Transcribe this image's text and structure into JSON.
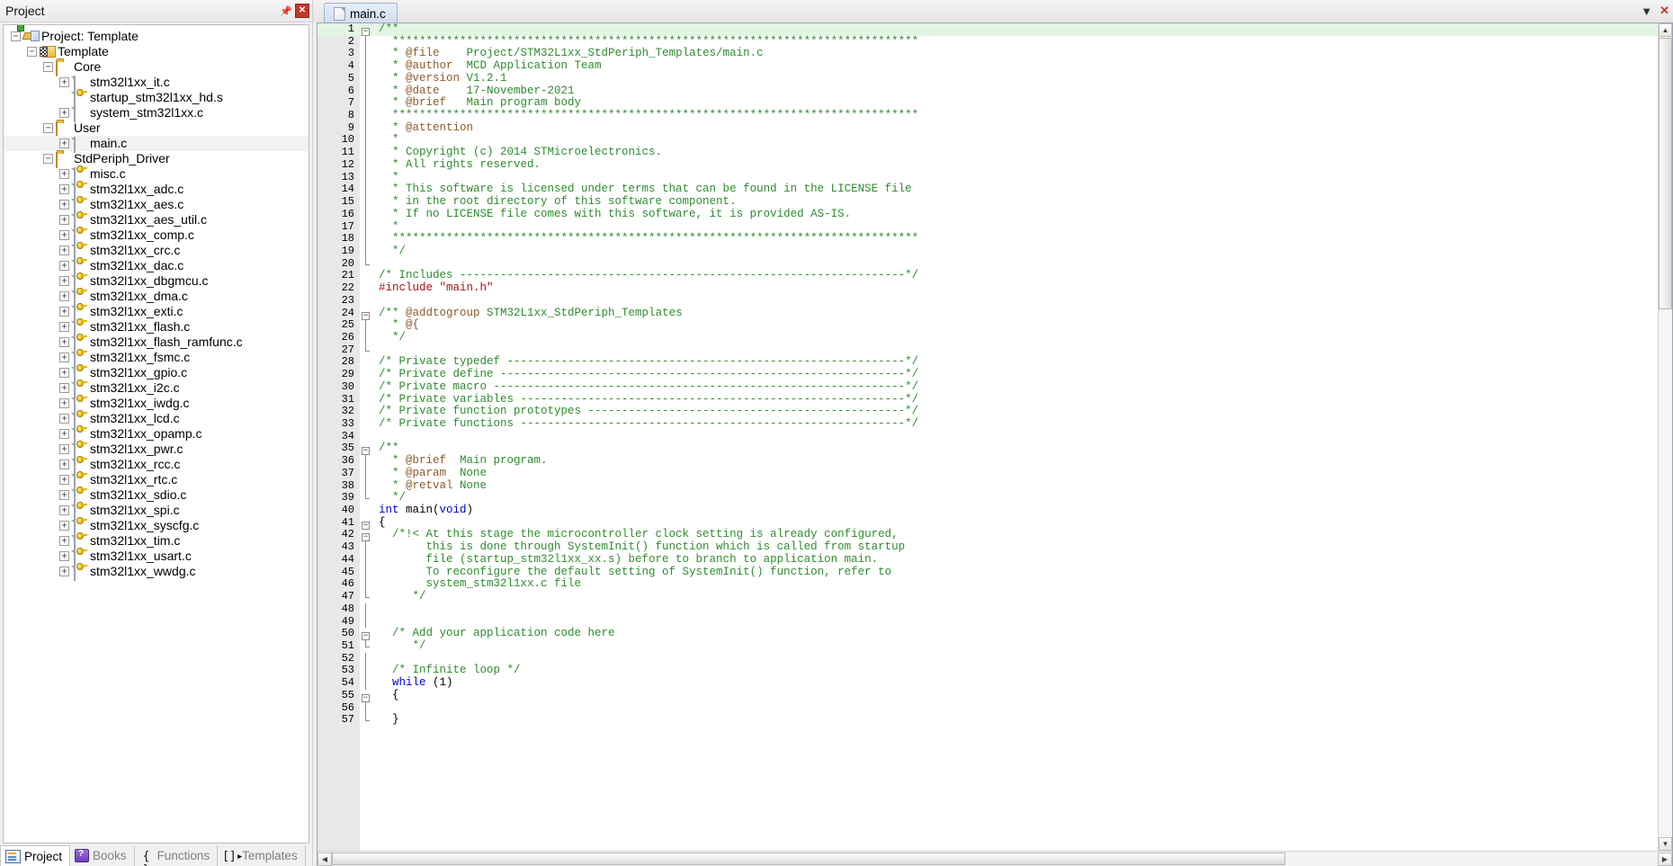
{
  "project_pane": {
    "title": "Project",
    "pin_icon": "pin-icon",
    "close_icon": "close-icon",
    "tree": [
      {
        "label": "Project: Template",
        "depth": 0,
        "icon": "project-icon",
        "expander": "minus"
      },
      {
        "label": "Template",
        "depth": 1,
        "icon": "target-icon",
        "expander": "minus"
      },
      {
        "label": "Core",
        "depth": 2,
        "icon": "folder-icon",
        "expander": "minus"
      },
      {
        "label": "stm32l1xx_it.c",
        "depth": 3,
        "icon": "file-icon",
        "expander": "plus"
      },
      {
        "label": "startup_stm32l1xx_hd.s",
        "depth": 3,
        "icon": "file-key-icon",
        "expander": "none"
      },
      {
        "label": "system_stm32l1xx.c",
        "depth": 3,
        "icon": "file-icon",
        "expander": "plus"
      },
      {
        "label": "User",
        "depth": 2,
        "icon": "folder-icon",
        "expander": "minus"
      },
      {
        "label": "main.c",
        "depth": 3,
        "icon": "file-icon",
        "expander": "plus",
        "selected": true
      },
      {
        "label": "StdPeriph_Driver",
        "depth": 2,
        "icon": "folder-icon",
        "expander": "minus"
      },
      {
        "label": "misc.c",
        "depth": 3,
        "icon": "file-key-icon",
        "expander": "plus"
      },
      {
        "label": "stm32l1xx_adc.c",
        "depth": 3,
        "icon": "file-key-icon",
        "expander": "plus"
      },
      {
        "label": "stm32l1xx_aes.c",
        "depth": 3,
        "icon": "file-key-icon",
        "expander": "plus"
      },
      {
        "label": "stm32l1xx_aes_util.c",
        "depth": 3,
        "icon": "file-key-icon",
        "expander": "plus"
      },
      {
        "label": "stm32l1xx_comp.c",
        "depth": 3,
        "icon": "file-key-icon",
        "expander": "plus"
      },
      {
        "label": "stm32l1xx_crc.c",
        "depth": 3,
        "icon": "file-key-icon",
        "expander": "plus"
      },
      {
        "label": "stm32l1xx_dac.c",
        "depth": 3,
        "icon": "file-key-icon",
        "expander": "plus"
      },
      {
        "label": "stm32l1xx_dbgmcu.c",
        "depth": 3,
        "icon": "file-key-icon",
        "expander": "plus"
      },
      {
        "label": "stm32l1xx_dma.c",
        "depth": 3,
        "icon": "file-key-icon",
        "expander": "plus"
      },
      {
        "label": "stm32l1xx_exti.c",
        "depth": 3,
        "icon": "file-key-icon",
        "expander": "plus"
      },
      {
        "label": "stm32l1xx_flash.c",
        "depth": 3,
        "icon": "file-key-icon",
        "expander": "plus"
      },
      {
        "label": "stm32l1xx_flash_ramfunc.c",
        "depth": 3,
        "icon": "file-key-icon",
        "expander": "plus"
      },
      {
        "label": "stm32l1xx_fsmc.c",
        "depth": 3,
        "icon": "file-key-icon",
        "expander": "plus"
      },
      {
        "label": "stm32l1xx_gpio.c",
        "depth": 3,
        "icon": "file-key-icon",
        "expander": "plus"
      },
      {
        "label": "stm32l1xx_i2c.c",
        "depth": 3,
        "icon": "file-key-icon",
        "expander": "plus"
      },
      {
        "label": "stm32l1xx_iwdg.c",
        "depth": 3,
        "icon": "file-key-icon",
        "expander": "plus"
      },
      {
        "label": "stm32l1xx_lcd.c",
        "depth": 3,
        "icon": "file-key-icon",
        "expander": "plus"
      },
      {
        "label": "stm32l1xx_opamp.c",
        "depth": 3,
        "icon": "file-key-icon",
        "expander": "plus"
      },
      {
        "label": "stm32l1xx_pwr.c",
        "depth": 3,
        "icon": "file-key-icon",
        "expander": "plus"
      },
      {
        "label": "stm32l1xx_rcc.c",
        "depth": 3,
        "icon": "file-key-icon",
        "expander": "plus"
      },
      {
        "label": "stm32l1xx_rtc.c",
        "depth": 3,
        "icon": "file-key-icon",
        "expander": "plus"
      },
      {
        "label": "stm32l1xx_sdio.c",
        "depth": 3,
        "icon": "file-key-icon",
        "expander": "plus"
      },
      {
        "label": "stm32l1xx_spi.c",
        "depth": 3,
        "icon": "file-key-icon",
        "expander": "plus"
      },
      {
        "label": "stm32l1xx_syscfg.c",
        "depth": 3,
        "icon": "file-key-icon",
        "expander": "plus"
      },
      {
        "label": "stm32l1xx_tim.c",
        "depth": 3,
        "icon": "file-key-icon",
        "expander": "plus"
      },
      {
        "label": "stm32l1xx_usart.c",
        "depth": 3,
        "icon": "file-key-icon",
        "expander": "plus"
      },
      {
        "label": "stm32l1xx_wwdg.c",
        "depth": 3,
        "icon": "file-key-icon",
        "expander": "plus"
      }
    ],
    "bottom_tabs": [
      {
        "label": "Project",
        "icon": "project-tab-icon",
        "active": true
      },
      {
        "label": "Books",
        "icon": "books-icon",
        "active": false
      },
      {
        "label": "Functions",
        "icon": "braces-icon",
        "active": false
      },
      {
        "label": "Templates",
        "icon": "templates-icon",
        "active": false
      }
    ]
  },
  "editor": {
    "tabs": [
      {
        "label": "main.c",
        "icon": "file-icon",
        "active": true
      }
    ],
    "tabbar_buttons": [
      {
        "name": "tab-list-dropdown",
        "glyph": "▼"
      },
      {
        "name": "close-document",
        "glyph": "✕"
      }
    ],
    "scroll": {
      "v_up_glyph": "▲",
      "v_down_glyph": "▼",
      "h_left_glyph": "◀",
      "h_right_glyph": "▶"
    },
    "code": [
      {
        "n": 1,
        "fold": "start",
        "hl": true,
        "tokens": [
          {
            "t": "/**",
            "c": "cmt"
          }
        ]
      },
      {
        "n": 2,
        "fold": "bar",
        "tokens": [
          {
            "t": "  ******************************************************************************",
            "c": "cmt"
          }
        ]
      },
      {
        "n": 3,
        "fold": "bar",
        "tokens": [
          {
            "t": "  * ",
            "c": "cmt"
          },
          {
            "t": "@file",
            "c": "cmt-tag"
          },
          {
            "t": "    Project/STM32L1xx_StdPeriph_Templates/main.c",
            "c": "cmt"
          }
        ]
      },
      {
        "n": 4,
        "fold": "bar",
        "tokens": [
          {
            "t": "  * ",
            "c": "cmt"
          },
          {
            "t": "@author",
            "c": "cmt-tag"
          },
          {
            "t": "  MCD Application Team",
            "c": "cmt"
          }
        ]
      },
      {
        "n": 5,
        "fold": "bar",
        "tokens": [
          {
            "t": "  * ",
            "c": "cmt"
          },
          {
            "t": "@version",
            "c": "cmt-tag"
          },
          {
            "t": " V1.2.1",
            "c": "cmt"
          }
        ]
      },
      {
        "n": 6,
        "fold": "bar",
        "tokens": [
          {
            "t": "  * ",
            "c": "cmt"
          },
          {
            "t": "@date",
            "c": "cmt-tag"
          },
          {
            "t": "    17-November-2021",
            "c": "cmt"
          }
        ]
      },
      {
        "n": 7,
        "fold": "bar",
        "tokens": [
          {
            "t": "  * ",
            "c": "cmt"
          },
          {
            "t": "@brief",
            "c": "cmt-tag"
          },
          {
            "t": "   Main program body",
            "c": "cmt"
          }
        ]
      },
      {
        "n": 8,
        "fold": "bar",
        "tokens": [
          {
            "t": "  ******************************************************************************",
            "c": "cmt"
          }
        ]
      },
      {
        "n": 9,
        "fold": "bar",
        "tokens": [
          {
            "t": "  * ",
            "c": "cmt"
          },
          {
            "t": "@attention",
            "c": "cmt-tag"
          }
        ]
      },
      {
        "n": 10,
        "fold": "bar",
        "tokens": [
          {
            "t": "  *",
            "c": "cmt"
          }
        ]
      },
      {
        "n": 11,
        "fold": "bar",
        "tokens": [
          {
            "t": "  * Copyright (c) 2014 STMicroelectronics.",
            "c": "cmt"
          }
        ]
      },
      {
        "n": 12,
        "fold": "bar",
        "tokens": [
          {
            "t": "  * All rights reserved.",
            "c": "cmt"
          }
        ]
      },
      {
        "n": 13,
        "fold": "bar",
        "tokens": [
          {
            "t": "  *",
            "c": "cmt"
          }
        ]
      },
      {
        "n": 14,
        "fold": "bar",
        "tokens": [
          {
            "t": "  * This software is licensed under terms that can be found in the LICENSE file",
            "c": "cmt"
          }
        ]
      },
      {
        "n": 15,
        "fold": "bar",
        "tokens": [
          {
            "t": "  * in the root directory of this software component.",
            "c": "cmt"
          }
        ]
      },
      {
        "n": 16,
        "fold": "bar",
        "tokens": [
          {
            "t": "  * If no LICENSE file comes with this software, it is provided AS-IS.",
            "c": "cmt"
          }
        ]
      },
      {
        "n": 17,
        "fold": "bar",
        "tokens": [
          {
            "t": "  *",
            "c": "cmt"
          }
        ]
      },
      {
        "n": 18,
        "fold": "bar",
        "tokens": [
          {
            "t": "  ******************************************************************************",
            "c": "cmt"
          }
        ]
      },
      {
        "n": 19,
        "fold": "bar",
        "tokens": [
          {
            "t": "  */",
            "c": "cmt"
          }
        ]
      },
      {
        "n": 20,
        "fold": "end",
        "tokens": []
      },
      {
        "n": 21,
        "fold": "none",
        "tokens": [
          {
            "t": "/* Includes ------------------------------------------------------------------*/",
            "c": "cmt"
          }
        ]
      },
      {
        "n": 22,
        "fold": "none",
        "tokens": [
          {
            "t": "#include ",
            "c": "pre"
          },
          {
            "t": "\"main.h\"",
            "c": "str"
          }
        ]
      },
      {
        "n": 23,
        "fold": "none",
        "tokens": []
      },
      {
        "n": 24,
        "fold": "start",
        "tokens": [
          {
            "t": "/** ",
            "c": "cmt"
          },
          {
            "t": "@addtogroup",
            "c": "cmt-tag"
          },
          {
            "t": " STM32L1xx_StdPeriph_Templates",
            "c": "cmt"
          }
        ]
      },
      {
        "n": 25,
        "fold": "bar",
        "tokens": [
          {
            "t": "  * ",
            "c": "cmt"
          },
          {
            "t": "@{",
            "c": "cmt-tag"
          }
        ]
      },
      {
        "n": 26,
        "fold": "bar",
        "tokens": [
          {
            "t": "  */",
            "c": "cmt"
          }
        ]
      },
      {
        "n": 27,
        "fold": "end",
        "tokens": []
      },
      {
        "n": 28,
        "fold": "none",
        "tokens": [
          {
            "t": "/* Private typedef -----------------------------------------------------------*/",
            "c": "cmt"
          }
        ]
      },
      {
        "n": 29,
        "fold": "none",
        "tokens": [
          {
            "t": "/* Private define ------------------------------------------------------------*/",
            "c": "cmt"
          }
        ]
      },
      {
        "n": 30,
        "fold": "none",
        "tokens": [
          {
            "t": "/* Private macro -------------------------------------------------------------*/",
            "c": "cmt"
          }
        ]
      },
      {
        "n": 31,
        "fold": "none",
        "tokens": [
          {
            "t": "/* Private variables ---------------------------------------------------------*/",
            "c": "cmt"
          }
        ]
      },
      {
        "n": 32,
        "fold": "none",
        "tokens": [
          {
            "t": "/* Private function prototypes -----------------------------------------------*/",
            "c": "cmt"
          }
        ]
      },
      {
        "n": 33,
        "fold": "none",
        "tokens": [
          {
            "t": "/* Private functions ---------------------------------------------------------*/",
            "c": "cmt"
          }
        ]
      },
      {
        "n": 34,
        "fold": "none",
        "tokens": []
      },
      {
        "n": 35,
        "fold": "start",
        "tokens": [
          {
            "t": "/**",
            "c": "cmt"
          }
        ]
      },
      {
        "n": 36,
        "fold": "bar",
        "tokens": [
          {
            "t": "  * ",
            "c": "cmt"
          },
          {
            "t": "@brief",
            "c": "cmt-tag"
          },
          {
            "t": "  Main program.",
            "c": "cmt"
          }
        ]
      },
      {
        "n": 37,
        "fold": "bar",
        "tokens": [
          {
            "t": "  * ",
            "c": "cmt"
          },
          {
            "t": "@param",
            "c": "cmt-tag"
          },
          {
            "t": "  None",
            "c": "cmt"
          }
        ]
      },
      {
        "n": 38,
        "fold": "bar",
        "tokens": [
          {
            "t": "  * ",
            "c": "cmt"
          },
          {
            "t": "@retval",
            "c": "cmt-tag"
          },
          {
            "t": " None",
            "c": "cmt"
          }
        ]
      },
      {
        "n": 39,
        "fold": "end",
        "tokens": [
          {
            "t": "  */",
            "c": "cmt"
          }
        ]
      },
      {
        "n": 40,
        "fold": "none",
        "tokens": [
          {
            "t": "int",
            "c": "kw"
          },
          {
            "t": " main(",
            "c": "plain"
          },
          {
            "t": "void",
            "c": "kw"
          },
          {
            "t": ")",
            "c": "plain"
          }
        ]
      },
      {
        "n": 41,
        "fold": "start",
        "tokens": [
          {
            "t": "{",
            "c": "plain"
          }
        ]
      },
      {
        "n": 42,
        "fold": "start2",
        "tokens": [
          {
            "t": "  /*!< At this stage the microcontroller clock setting is already configured,",
            "c": "cmt"
          }
        ]
      },
      {
        "n": 43,
        "fold": "bar2",
        "tokens": [
          {
            "t": "       this is done through SystemInit() function which is called from startup",
            "c": "cmt"
          }
        ]
      },
      {
        "n": 44,
        "fold": "bar2",
        "tokens": [
          {
            "t": "       file (startup_stm32l1xx_xx.s) before to branch to application main.",
            "c": "cmt"
          }
        ]
      },
      {
        "n": 45,
        "fold": "bar2",
        "tokens": [
          {
            "t": "       To reconfigure the default setting of SystemInit() function, refer to",
            "c": "cmt"
          }
        ]
      },
      {
        "n": 46,
        "fold": "bar2",
        "tokens": [
          {
            "t": "       system_stm32l1xx.c file",
            "c": "cmt"
          }
        ]
      },
      {
        "n": 47,
        "fold": "end2",
        "tokens": [
          {
            "t": "     */",
            "c": "cmt"
          }
        ]
      },
      {
        "n": 48,
        "fold": "bar",
        "tokens": []
      },
      {
        "n": 49,
        "fold": "bar",
        "tokens": []
      },
      {
        "n": 50,
        "fold": "start2",
        "tokens": [
          {
            "t": "  /* Add your application code here",
            "c": "cmt"
          }
        ]
      },
      {
        "n": 51,
        "fold": "end2",
        "tokens": [
          {
            "t": "     */",
            "c": "cmt"
          }
        ]
      },
      {
        "n": 52,
        "fold": "bar",
        "tokens": []
      },
      {
        "n": 53,
        "fold": "bar",
        "tokens": [
          {
            "t": "  /* Infinite loop */",
            "c": "cmt"
          }
        ]
      },
      {
        "n": 54,
        "fold": "bar",
        "tokens": [
          {
            "t": "  ",
            "c": "plain"
          },
          {
            "t": "while",
            "c": "kw"
          },
          {
            "t": " (1)",
            "c": "plain"
          }
        ]
      },
      {
        "n": 55,
        "fold": "start2",
        "tokens": [
          {
            "t": "  {",
            "c": "plain"
          }
        ]
      },
      {
        "n": 56,
        "fold": "bar2",
        "tokens": []
      },
      {
        "n": 57,
        "fold": "end2",
        "tokens": [
          {
            "t": "  }",
            "c": "plain"
          }
        ]
      }
    ]
  }
}
